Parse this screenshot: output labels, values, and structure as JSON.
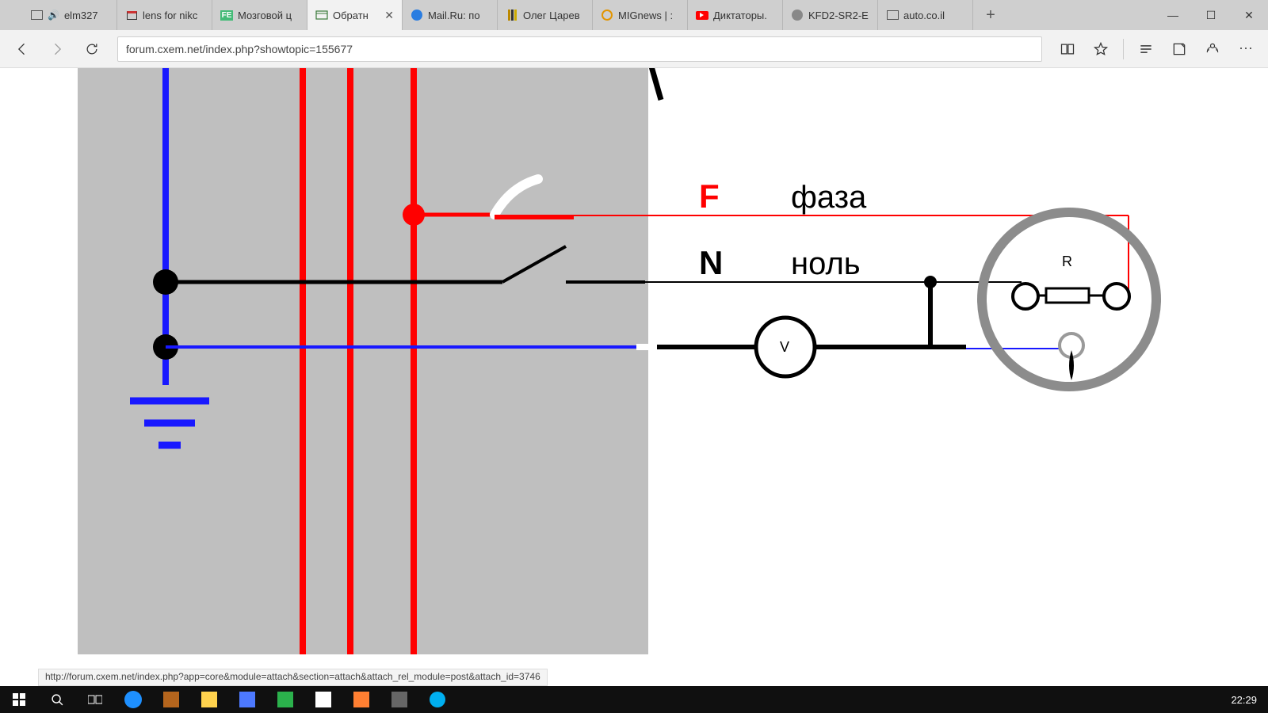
{
  "tabs": [
    {
      "label": "elm327"
    },
    {
      "label": "lens for nikс"
    },
    {
      "label": "Мозговой ц"
    },
    {
      "label": "Обратн"
    },
    {
      "label": "Mail.Ru: по"
    },
    {
      "label": "Олег Царев"
    },
    {
      "label": "MIGnews | :"
    },
    {
      "label": "Диктаторы."
    },
    {
      "label": "KFD2-SR2-E"
    },
    {
      "label": "auto.co.il"
    }
  ],
  "activeTabIndex": 3,
  "url": "forum.cxem.net/index.php?showtopic=155677",
  "statusUrl": "http://forum.cxem.net/index.php?app=core&module=attach&section=attach&attach_rel_module=post&attach_id=3746",
  "clock": "22:29",
  "diagram": {
    "F": "F",
    "N": "N",
    "phase": "фаза",
    "neutral": "ноль",
    "V": "V",
    "R": "R"
  }
}
